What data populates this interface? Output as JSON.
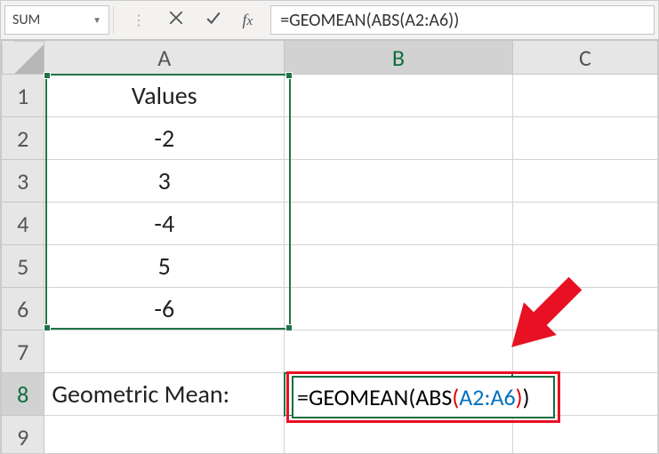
{
  "formula_bar": {
    "name_box": "SUM",
    "formula": "=GEOMEAN(ABS(A2:A6))"
  },
  "columns": [
    "A",
    "B",
    "C"
  ],
  "rows": [
    "1",
    "2",
    "3",
    "4",
    "5",
    "6",
    "7",
    "8",
    "9"
  ],
  "cells": {
    "A1": "Values",
    "A2": "-2",
    "A3": "3",
    "A4": "-4",
    "A5": "5",
    "A6": "-6",
    "A8": "Geometric Mean:"
  },
  "editing": {
    "address": "B8",
    "tokens": {
      "eq": "=",
      "fn1": "GEOMEAN",
      "lp1": "(",
      "fn2": "ABS",
      "lp2": "(",
      "ref": "A2:A6",
      "rp2": ")",
      "rp1": ")"
    }
  },
  "chart_data": {
    "type": "table",
    "title": "Values",
    "categories": [
      "A2",
      "A3",
      "A4",
      "A5",
      "A6"
    ],
    "values": [
      -2,
      3,
      -4,
      5,
      -6
    ]
  }
}
